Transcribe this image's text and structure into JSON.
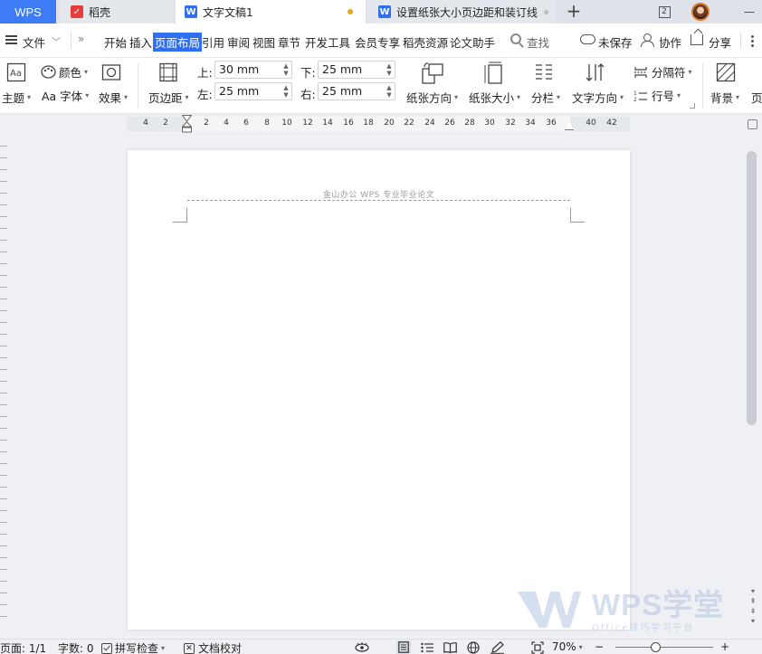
{
  "tabs": {
    "wps": "WPS",
    "daoke": "稻壳",
    "doc1": "文字文稿1",
    "doc2": "设置纸张大小页边距和装订线",
    "badge_count": "2"
  },
  "menu": {
    "file": "文件",
    "items": [
      "开始",
      "插入",
      "页面布局",
      "引用",
      "审阅",
      "视图",
      "章节",
      "开发工具",
      "会员专享",
      "稻壳资源",
      "论文助手"
    ],
    "active_item": "页面布局",
    "search": "查找",
    "unsaved": "未保存",
    "collab": "协作",
    "share": "分享"
  },
  "ribbon": {
    "color": "颜色",
    "theme": "主题",
    "font": "Aa 字体",
    "effect": "效果",
    "margins": "页边距",
    "top_label": "上:",
    "top_value": "30 mm",
    "bottom_label": "下:",
    "bottom_value": "25 mm",
    "left_label": "左:",
    "left_value": "25 mm",
    "right_label": "右:",
    "right_value": "25 mm",
    "orientation": "纸张方向",
    "size": "纸张大小",
    "columns": "分栏",
    "text_direction": "文字方向",
    "breaks": "分隔符",
    "line_numbers": "行号",
    "background": "背景",
    "page_border": "页"
  },
  "ruler": {
    "numbers": [
      "4",
      "2",
      "2",
      "4",
      "6",
      "8",
      "10",
      "12",
      "14",
      "16",
      "18",
      "20",
      "22",
      "24",
      "26",
      "28",
      "30",
      "32",
      "34",
      "36",
      "",
      "40",
      "42"
    ]
  },
  "document": {
    "header_text": "金山办公 WPS 专业毕业论文"
  },
  "watermark": {
    "title": "WPS学堂",
    "subtitle": "Office技巧学习平台"
  },
  "status": {
    "page": "页面: 1/1",
    "word_count": "字数: 0",
    "spell_check": "拼写检查",
    "proofread": "文档校对",
    "zoom": "70%",
    "zoom_minus": "−",
    "zoom_plus": "+"
  },
  "colors": {
    "accent": "#2f6ff0",
    "wps_tab": "#3d7cf5",
    "unsaved_dot": "#e6a61a"
  }
}
